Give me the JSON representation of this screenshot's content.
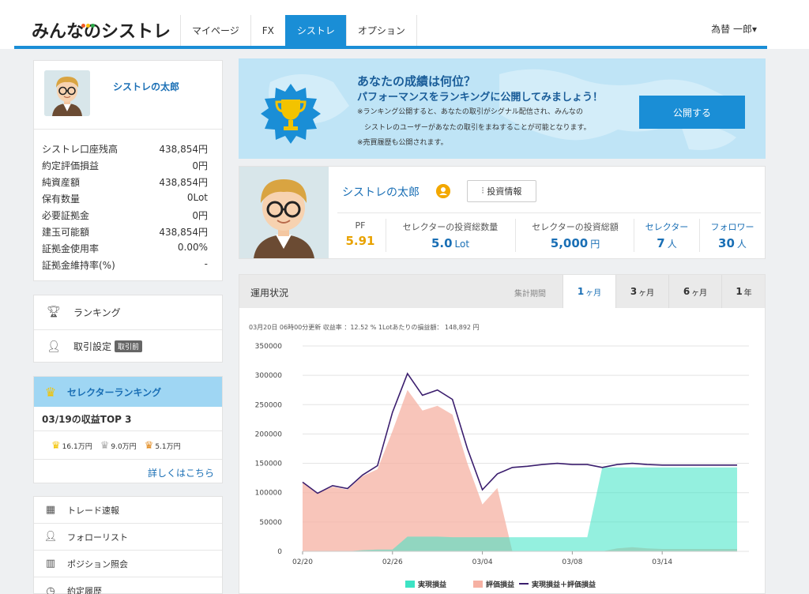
{
  "header": {
    "logo": "みんなのシストレ",
    "tabs": [
      {
        "label": "マイページ"
      },
      {
        "label": "FX"
      },
      {
        "label": "シストレ"
      },
      {
        "label": "オプション"
      }
    ],
    "active_tab": "シストレ",
    "user": "為替 一郎▾"
  },
  "sidebar": {
    "profile_name": "シストレの太郎",
    "stats": [
      {
        "label": "シストレ口座残高",
        "value": "438,854円"
      },
      {
        "label": "約定評価損益",
        "value": "0円"
      },
      {
        "label": "純資産額",
        "value": "438,854円"
      },
      {
        "label": "保有数量",
        "value": "0Lot"
      },
      {
        "label": "必要証拠金",
        "value": "0円"
      },
      {
        "label": "建玉可能額",
        "value": "438,854円"
      },
      {
        "label": "証拠金使用率",
        "value": "0.00%"
      },
      {
        "label": "証拠金維持率(%)",
        "value": "-"
      }
    ],
    "menu": [
      {
        "label": "ランキング"
      },
      {
        "label": "取引設定",
        "badge": "取引前"
      }
    ],
    "ranking": {
      "header": "セレクターランキング",
      "title": "03/19の収益TOP 3",
      "values": [
        "16.1万円",
        "9.0万円",
        "5.1万円"
      ],
      "link": "詳しくはこちら"
    },
    "menu2": [
      {
        "label": "トレード速報"
      },
      {
        "label": "フォローリスト"
      },
      {
        "label": "ポジション照会"
      },
      {
        "label": "約定履歴"
      }
    ]
  },
  "banner": {
    "title": "あなたの成績は何位？",
    "subtitle": "パフォーマンスをランキングに公開してみましょう！",
    "lines": [
      "※ランキング公開すると、あなたの取引がシグナル配信され、みんなの",
      "　シストレのユーザーがあなたの取引をまねすることが可能となります。",
      "※売買履歴も公開されます。"
    ],
    "button": "公開する"
  },
  "trader": {
    "name": "シストレの太郎",
    "invest_button": "投資情報",
    "metrics": [
      {
        "label": "PF",
        "value": "5.91",
        "unit": "",
        "color": "#e8a200"
      },
      {
        "label": "セレクターの投資総数量",
        "value": "5.0",
        "unit": "Lot",
        "color": "#1a6fb5"
      },
      {
        "label": "セレクターの投資総額",
        "value": "5,000",
        "unit": "円",
        "color": "#1a6fb5"
      },
      {
        "label": "セレクター",
        "value": "7",
        "unit": "人",
        "color": "#1a6fb5"
      },
      {
        "label": "フォロワー",
        "value": "30",
        "unit": "人",
        "color": "#1a6fb5"
      }
    ]
  },
  "panel": {
    "title": "運用状況",
    "period_label": "集計期間",
    "periods": [
      {
        "num": "1",
        "unit": "ヶ月"
      },
      {
        "num": "3",
        "unit": "ヶ月"
      },
      {
        "num": "6",
        "unit": "ヶ月"
      },
      {
        "num": "1",
        "unit": "年"
      }
    ],
    "active_period": 0,
    "note": "03月20日 06時00分更新 収益率 ：12.52 % 1Lotあたりの損益額： 148,892 円"
  },
  "chart_data": {
    "type": "area",
    "x_ticks": [
      "02/20",
      "02/26",
      "03/04",
      "03/08",
      "03/14"
    ],
    "x_tick_index": [
      0,
      6,
      12,
      18,
      24
    ],
    "ylim": [
      0,
      350000
    ],
    "y_ticks": [
      0,
      50000,
      100000,
      150000,
      200000,
      250000,
      300000,
      350000
    ],
    "y_tick_labels": [
      "0",
      "50000",
      "100000",
      "150000",
      "200000",
      "250000",
      "300000",
      "350000"
    ],
    "n_points": 30,
    "series": [
      {
        "name": "実現損益",
        "color": "#3de3c4",
        "values": [
          0,
          0,
          0,
          0,
          2000,
          3000,
          3000,
          25000,
          25000,
          25000,
          24000,
          24000,
          24000,
          24000,
          24000,
          24000,
          24000,
          24000,
          24000,
          24000,
          143000,
          143000,
          143000,
          143000,
          143000,
          143000,
          143000,
          143000,
          143000,
          143000
        ]
      },
      {
        "name": "評価損益",
        "color": "#f6b1a3",
        "values": [
          118000,
          99000,
          110000,
          105000,
          128000,
          140000,
          205000,
          275000,
          240000,
          248000,
          233000,
          150000,
          80000,
          108000,
          0,
          0,
          0,
          0,
          0,
          0,
          0,
          5000,
          7000,
          5000,
          4000,
          4000,
          4000,
          4000,
          4000,
          4000
        ]
      },
      {
        "name": "実現損益＋評価損益",
        "color": "#3b1e6e",
        "values": [
          118000,
          99000,
          112000,
          107000,
          130000,
          146000,
          237000,
          303000,
          266000,
          275000,
          259000,
          175000,
          105000,
          132000,
          143000,
          145000,
          148000,
          150000,
          148000,
          148000,
          143000,
          148000,
          150000,
          148000,
          147000,
          147000,
          147000,
          147000,
          147000,
          147000
        ]
      }
    ],
    "legend_placement": "bottom"
  }
}
